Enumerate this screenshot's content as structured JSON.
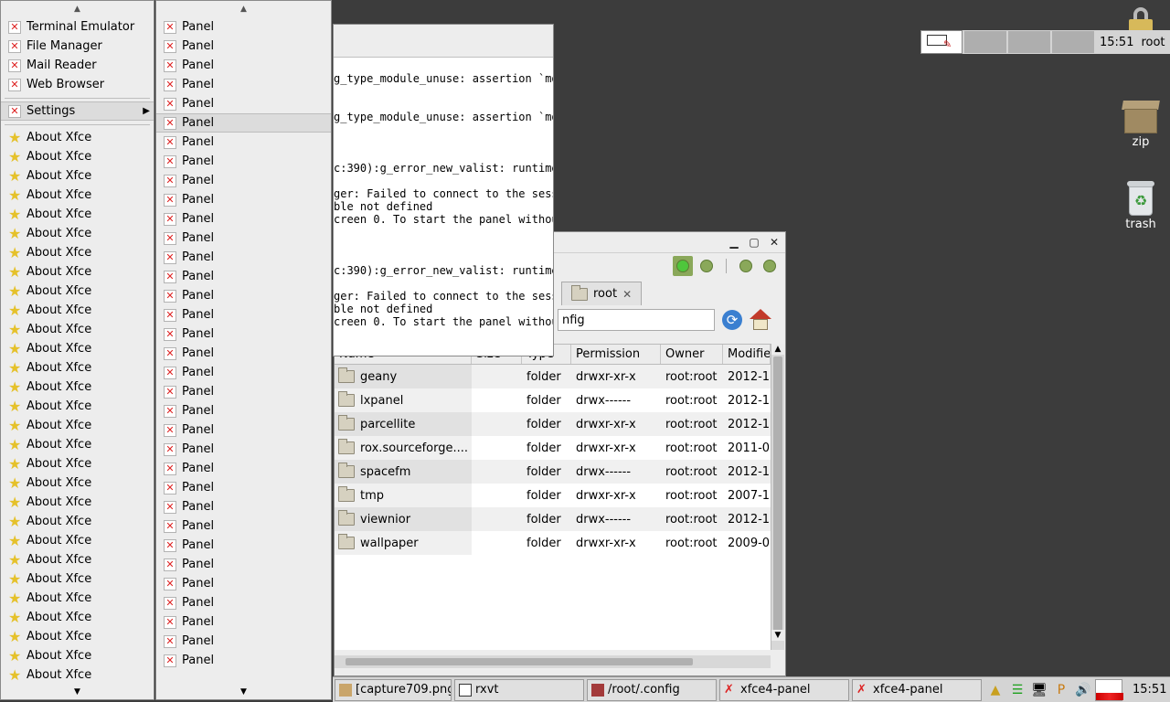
{
  "desktop": {
    "icons": [
      {
        "label": "lock"
      },
      {
        "label": "zip"
      },
      {
        "label": "trash"
      }
    ]
  },
  "menu_main": {
    "apps": [
      "Terminal Emulator",
      "File Manager",
      "Mail Reader",
      "Web Browser"
    ],
    "settings_label": "Settings",
    "about_label": "About Xfce",
    "about_count": 29
  },
  "menu_sub": {
    "item_label": "Panel",
    "item_count": 34,
    "selected_index": 5
  },
  "terminal": {
    "lines": [
      "",
      "g_type_module_unuse: assertion `mo",
      "",
      "",
      "g_type_module_unuse: assertion `mo",
      "",
      "",
      "",
      "c:390):g_error_new_valist: runtime",
      "",
      "ger: Failed to connect to the sess",
      "ble not defined",
      "creen 0. To start the panel withou",
      "",
      "",
      "",
      "c:390):g_error_new_valist: runtime",
      "",
      "ger: Failed to connect to the sess",
      "ble not defined",
      "creen 0. To start the panel withou"
    ]
  },
  "file_manager": {
    "tab_label": "root",
    "path_value": "nfig",
    "columns": [
      "Name",
      "Size",
      "Type",
      "Permission",
      "Owner",
      "Modifie"
    ],
    "rows": [
      {
        "name": "geany",
        "type": "folder",
        "perm": "drwxr-xr-x",
        "owner": "root:root",
        "mod": "2012-1"
      },
      {
        "name": "lxpanel",
        "type": "folder",
        "perm": "drwx------",
        "owner": "root:root",
        "mod": "2012-1"
      },
      {
        "name": "parcellite",
        "type": "folder",
        "perm": "drwxr-xr-x",
        "owner": "root:root",
        "mod": "2012-1"
      },
      {
        "name": "rox.sourceforge....",
        "type": "folder",
        "perm": "drwxr-xr-x",
        "owner": "root:root",
        "mod": "2011-0"
      },
      {
        "name": "spacefm",
        "type": "folder",
        "perm": "drwx------",
        "owner": "root:root",
        "mod": "2012-1"
      },
      {
        "name": "tmp",
        "type": "folder",
        "perm": "drwxr-xr-x",
        "owner": "root:root",
        "mod": "2007-1"
      },
      {
        "name": "viewnior",
        "type": "folder",
        "perm": "drwx------",
        "owner": "root:root",
        "mod": "2012-1"
      },
      {
        "name": "wallpaper",
        "type": "folder",
        "perm": "drwxr-xr-x",
        "owner": "root:root",
        "mod": "2009-0"
      }
    ]
  },
  "top_panel": {
    "clock": "15:51",
    "user": "root"
  },
  "taskbar": {
    "tasks": [
      "[capture709.png -",
      "rxvt",
      "/root/.config",
      "xfce4-panel",
      "xfce4-panel"
    ],
    "clock": "15:51"
  },
  "colors": {
    "desktop_bg": "#3c3c3c",
    "accent_green": "#4fc63c",
    "error_red": "#d22222"
  }
}
